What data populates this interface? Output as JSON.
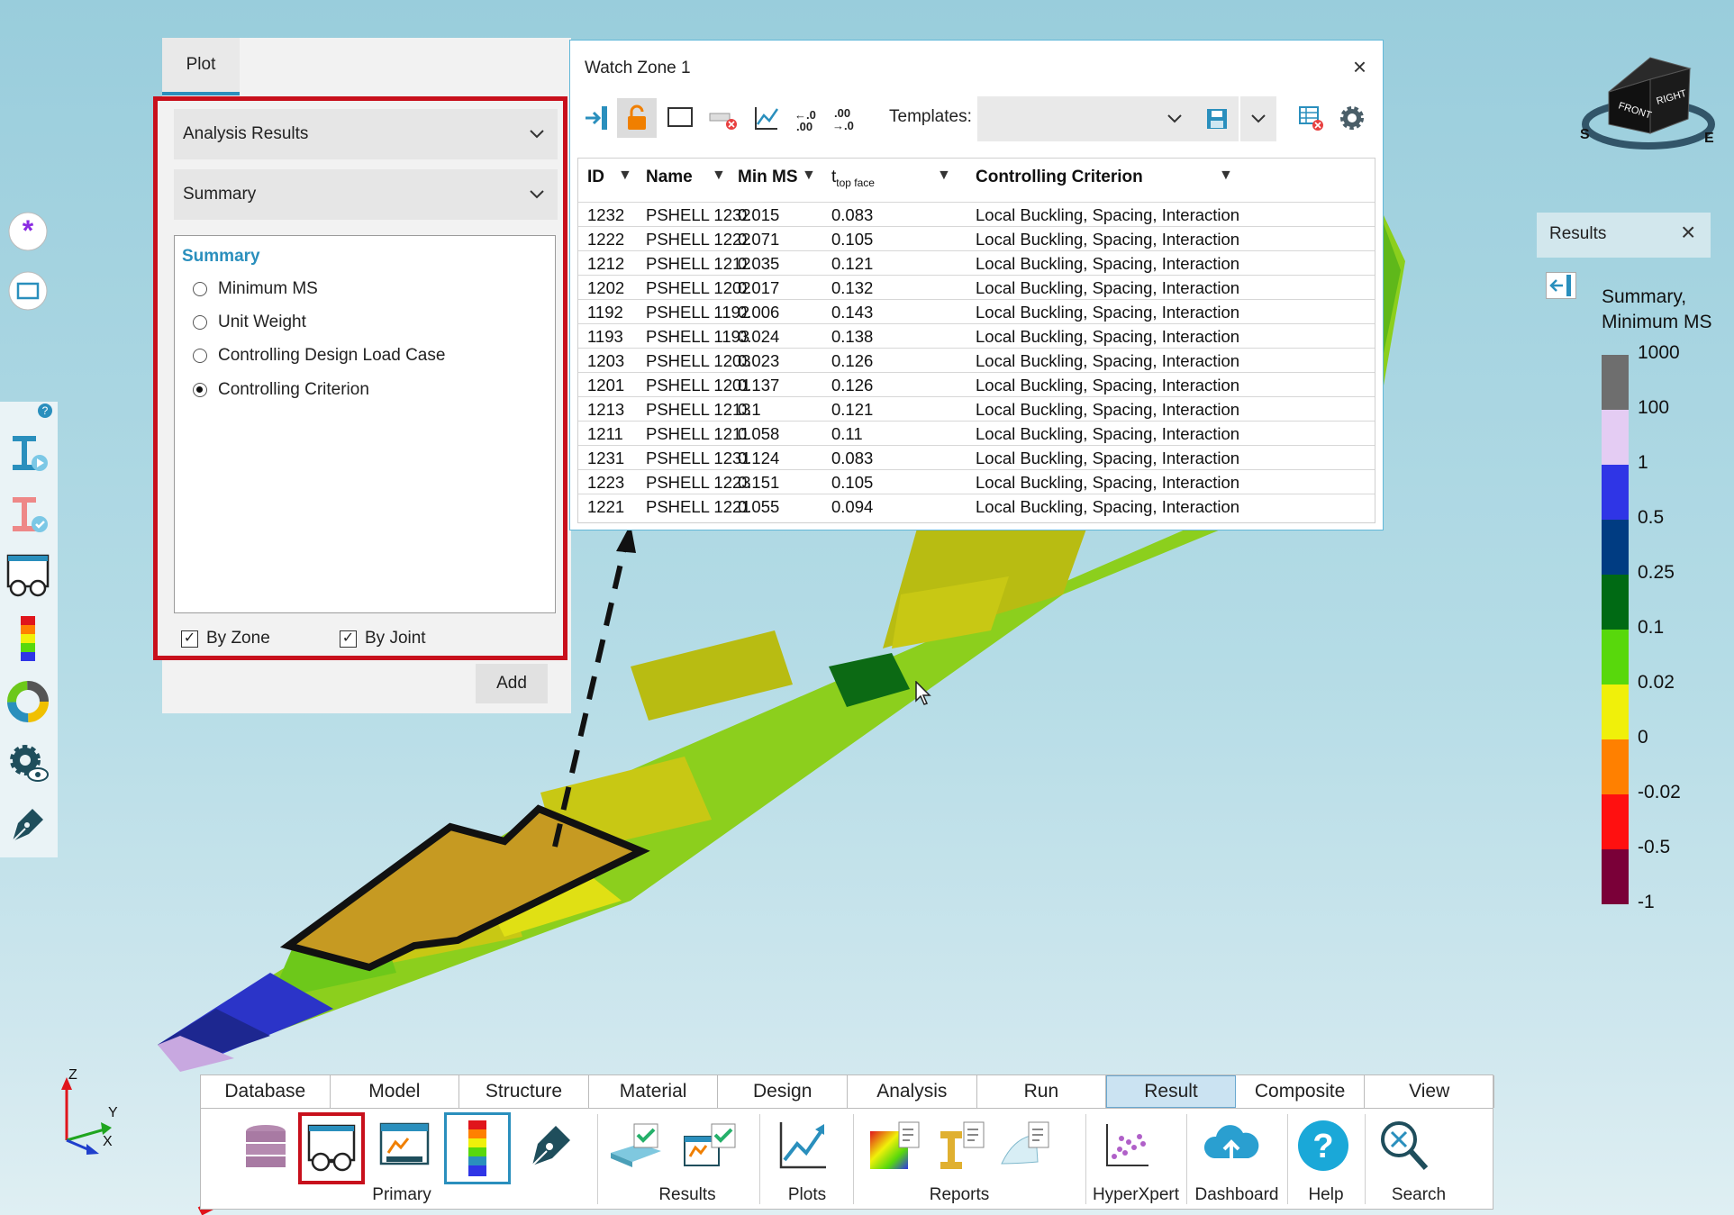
{
  "plot_panel": {
    "tab": "Plot",
    "dropdown1": "Analysis Results",
    "dropdown2": "Summary",
    "group_title": "Summary",
    "options": [
      "Minimum MS",
      "Unit Weight",
      "Controlling Design Load Case",
      "Controlling Criterion"
    ],
    "selected_option": "Controlling Criterion",
    "by_zone": "By Zone",
    "by_joint": "By Joint",
    "add": "Add"
  },
  "watch_zone": {
    "title": "Watch Zone 1",
    "close": "×",
    "templates_label": "Templates:",
    "templates_value": "",
    "columns": {
      "id": "ID",
      "name": "Name",
      "min_ms": "Min MS",
      "t_main": "t",
      "t_sub": "top face",
      "criterion": "Controlling Criterion"
    },
    "rows": [
      {
        "id": "1232",
        "name": "PSHELL 1232",
        "min_ms": "0.015",
        "t": "0.083",
        "crit": "Local Buckling, Spacing, Interaction"
      },
      {
        "id": "1222",
        "name": "PSHELL 1222",
        "min_ms": "0.071",
        "t": "0.105",
        "crit": "Local Buckling, Spacing, Interaction"
      },
      {
        "id": "1212",
        "name": "PSHELL 1212",
        "min_ms": "0.035",
        "t": "0.121",
        "crit": "Local Buckling, Spacing, Interaction"
      },
      {
        "id": "1202",
        "name": "PSHELL 1202",
        "min_ms": "0.017",
        "t": "0.132",
        "crit": "Local Buckling, Spacing, Interaction"
      },
      {
        "id": "1192",
        "name": "PSHELL 1192",
        "min_ms": "0.006",
        "t": "0.143",
        "crit": "Local Buckling, Spacing, Interaction"
      },
      {
        "id": "1193",
        "name": "PSHELL 1193",
        "min_ms": "0.024",
        "t": "0.138",
        "crit": "Local Buckling, Spacing, Interaction"
      },
      {
        "id": "1203",
        "name": "PSHELL 1203",
        "min_ms": "0.023",
        "t": "0.126",
        "crit": "Local Buckling, Spacing, Interaction"
      },
      {
        "id": "1201",
        "name": "PSHELL 1201",
        "min_ms": "0.137",
        "t": "0.126",
        "crit": "Local Buckling, Spacing, Interaction"
      },
      {
        "id": "1213",
        "name": "PSHELL 1213",
        "min_ms": "0.1",
        "t": "0.121",
        "crit": "Local Buckling, Spacing, Interaction"
      },
      {
        "id": "1211",
        "name": "PSHELL 1211",
        "min_ms": "0.058",
        "t": "0.11",
        "crit": "Local Buckling, Spacing, Interaction"
      },
      {
        "id": "1231",
        "name": "PSHELL 1231",
        "min_ms": "0.124",
        "t": "0.083",
        "crit": "Local Buckling, Spacing, Interaction"
      },
      {
        "id": "1223",
        "name": "PSHELL 1223",
        "min_ms": "0.151",
        "t": "0.105",
        "crit": "Local Buckling, Spacing, Interaction"
      },
      {
        "id": "1221",
        "name": "PSHELL 1221",
        "min_ms": "0.055",
        "t": "0.094",
        "crit": "Local Buckling, Spacing, Interaction"
      }
    ]
  },
  "results_panel": {
    "title": "Results",
    "close": "×",
    "legend_title_1": "Summary,",
    "legend_title_2": "Minimum MS",
    "legend_labels": [
      "1000",
      "100",
      "1",
      "0.5",
      "0.25",
      "0.1",
      "0.02",
      "0",
      "-0.02",
      "-0.5",
      "-1"
    ],
    "legend_colors": [
      "#6e6e6e",
      "#e4ccf3",
      "#2f35e6",
      "#003c82",
      "#006a14",
      "#58d80c",
      "#f0f00a",
      "#ff8000",
      "#ff1010",
      "#7a0038"
    ]
  },
  "view_cube": {
    "front": "FRONT",
    "right": "RIGHT",
    "compass_s": "S",
    "compass_e": "E"
  },
  "axes": {
    "z": "Z",
    "y": "Y",
    "x": "X"
  },
  "ribbon": {
    "tabs": [
      "Database",
      "Model",
      "Structure",
      "Material",
      "Design",
      "Analysis",
      "Run",
      "Result",
      "Composite",
      "View"
    ],
    "selected_tab": "Result",
    "groups": {
      "primary": "Primary",
      "results": "Results",
      "plots": "Plots",
      "reports": "Reports",
      "hyperxpert": "HyperXpert",
      "dashboard": "Dashboard",
      "help": "Help",
      "search": "Search"
    }
  },
  "colors": {
    "accent": "#2a8fbd",
    "highlight_red": "#c8101c"
  }
}
